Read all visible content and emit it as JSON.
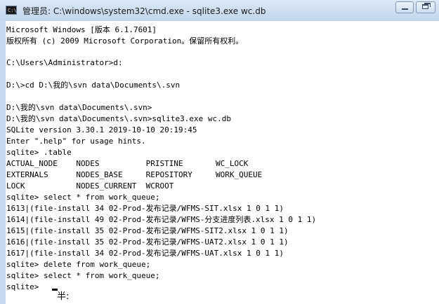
{
  "window": {
    "title": "管理员: C:\\windows\\system32\\cmd.exe - sqlite3.exe  wc.db",
    "icon": "cmd-icon",
    "icon_text": "C:\\"
  },
  "console": {
    "lines": [
      "Microsoft Windows [版本 6.1.7601]",
      "版权所有 (c) 2009 Microsoft Corporation。保留所有权利。",
      "",
      "C:\\Users\\Administrator>d:",
      "",
      "D:\\>cd D:\\我的\\svn data\\Documents\\.svn",
      "",
      "D:\\我的\\svn data\\Documents\\.svn>",
      "D:\\我的\\svn data\\Documents\\.svn>sqlite3.exe wc.db",
      "SQLite version 3.30.1 2019-10-10 20:19:45",
      "Enter \".help\" for usage hints.",
      "sqlite> .table",
      "ACTUAL_NODE    NODES          PRISTINE       WC_LOCK",
      "EXTERNALS      NODES_BASE     REPOSITORY     WORK_QUEUE",
      "LOCK           NODES_CURRENT  WCROOT",
      "sqlite> select * from work_queue;",
      "1613|(file-install 34 02-Prod-发布记录/WFMS-SIT.xlsx 1 0 1 1)",
      "1614|(file-install 49 02-Prod-发布记录/WFMS-分支进度列表.xlsx 1 0 1 1)",
      "1615|(file-install 35 02-Prod-发布记录/WFMS-SIT2.xlsx 1 0 1 1)",
      "1616|(file-install 35 02-Prod-发布记录/WFMS-UAT2.xlsx 1 0 1 1)",
      "1617|(file-install 34 02-Prod-发布记录/WFMS-UAT.xlsx 1 0 1 1)",
      "sqlite> delete from work_queue;",
      "sqlite> select * from work_queue;",
      "sqlite>"
    ],
    "ime_indicator": "半:"
  }
}
